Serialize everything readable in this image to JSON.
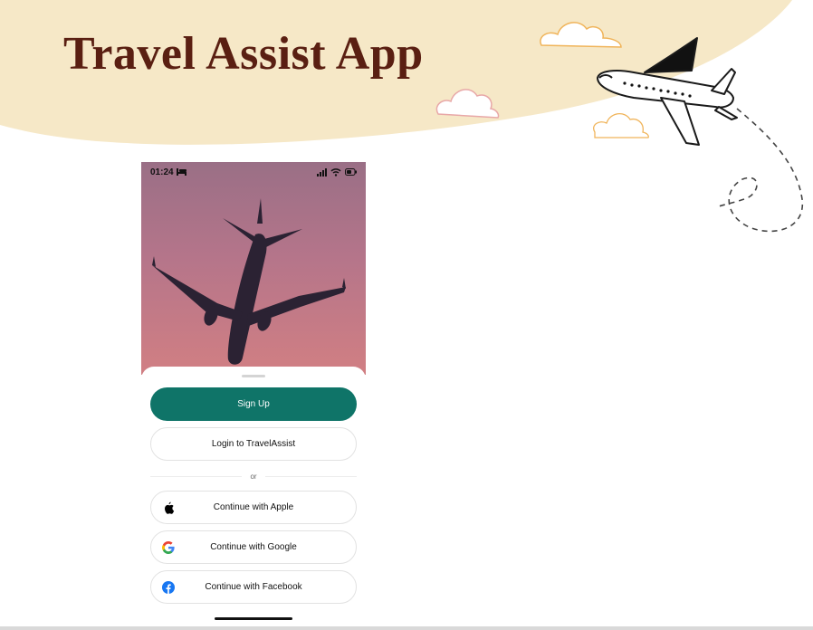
{
  "slide": {
    "title": "Travel Assist App",
    "banner_color": "#f6e8c7",
    "title_color": "#5a1f12"
  },
  "phone": {
    "status_bar": {
      "time": "01:24",
      "icons": [
        "bed-icon",
        "signal-icon",
        "wifi-icon",
        "battery-icon"
      ]
    },
    "hero_image": "airplane-silhouette-pink-sky",
    "buttons": {
      "sign_up": "Sign Up",
      "login": "Login to TravelAssist",
      "apple": "Continue with Apple",
      "google": "Continue with Google",
      "facebook": "Continue with Facebook"
    },
    "divider_text": "or",
    "accent_color": "#0f7468"
  }
}
